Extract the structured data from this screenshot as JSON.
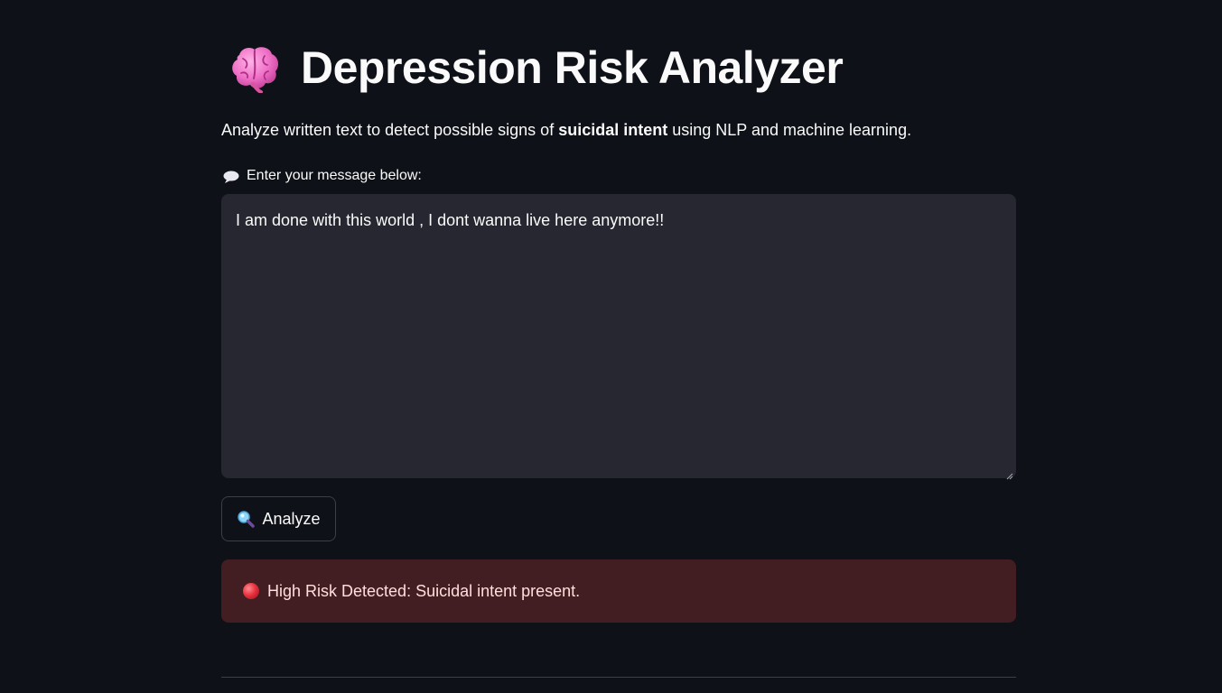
{
  "header": {
    "title": "Depression Risk Analyzer",
    "title_icon": "brain-icon"
  },
  "description": {
    "before": "Analyze written text to detect possible signs of ",
    "bold": "suicidal intent",
    "after": " using NLP and machine learning."
  },
  "input": {
    "label_icon": "speech-balloon-icon",
    "label": "Enter your message below:",
    "value": "I am done with this world , I dont wanna live here anymore!!"
  },
  "analyze_button": {
    "icon": "magnifier-icon",
    "label": "Analyze"
  },
  "result": {
    "icon": "red-circle-icon",
    "text": "High Risk Detected: Suicidal intent present.",
    "status_color": "#ff4b4b"
  },
  "colors": {
    "background": "#0e1117",
    "input_background": "#262730",
    "text": "#fafafa",
    "error_background": "rgba(255, 75, 75, 0.22)"
  }
}
